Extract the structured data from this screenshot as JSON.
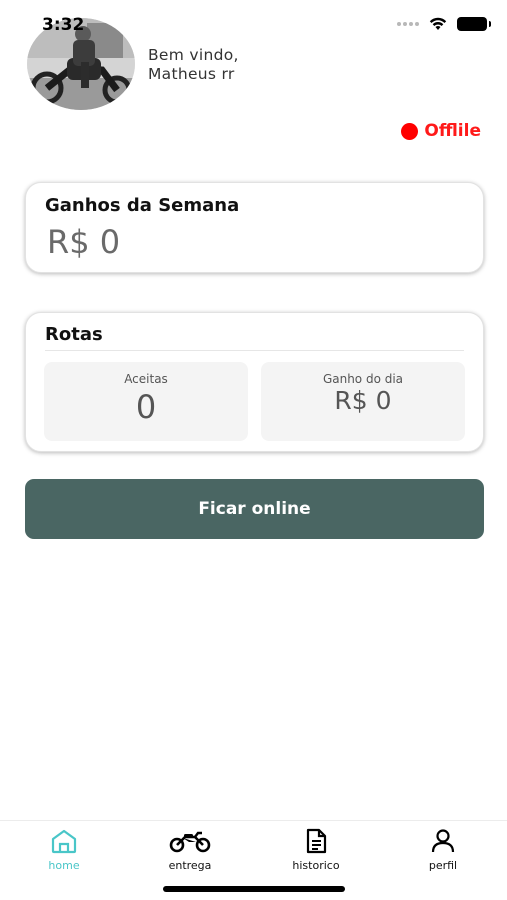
{
  "status_bar": {
    "time": "3:32"
  },
  "header": {
    "greeting_line1": "Bem vindo,",
    "greeting_line2": "Matheus rr",
    "status_text": "Offlile",
    "status_color": "#ff0000"
  },
  "earnings_card": {
    "title": "Ganhos da Semana",
    "value": "R$ 0"
  },
  "routes_card": {
    "title": "Rotas",
    "accepted_label": "Aceitas",
    "accepted_value": "0",
    "daily_label": "Ganho do dia",
    "daily_value": "R$ 0"
  },
  "cta": {
    "label": "Ficar online",
    "color": "#4a6663"
  },
  "tabs": [
    {
      "label": "home",
      "icon": "home-icon",
      "active": true
    },
    {
      "label": "entrega",
      "icon": "motorcycle-icon",
      "active": false
    },
    {
      "label": "historico",
      "icon": "document-icon",
      "active": false
    },
    {
      "label": "perfil",
      "icon": "user-icon",
      "active": false
    }
  ],
  "accent_color": "#49c6c8"
}
